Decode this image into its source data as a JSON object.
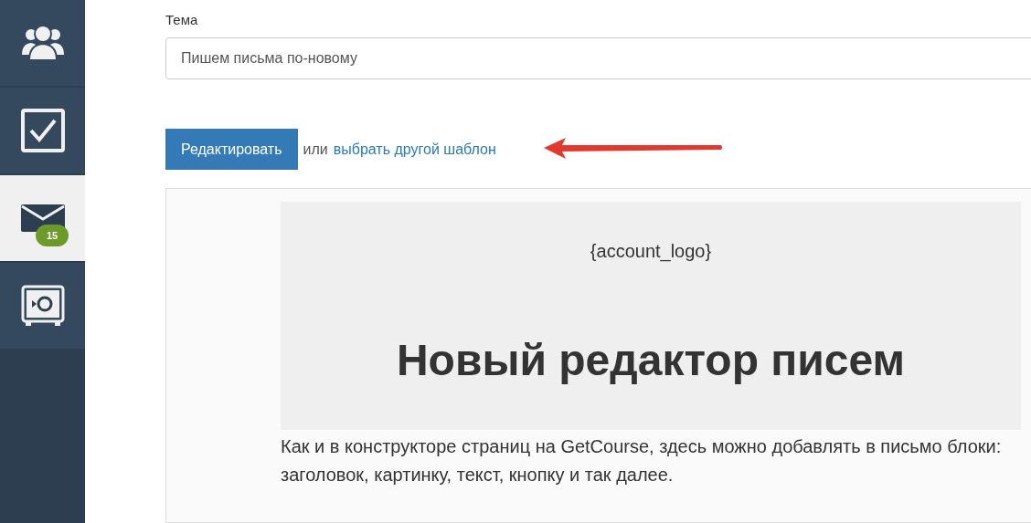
{
  "sidebar": {
    "items": [
      {
        "kind": "users",
        "selected": false
      },
      {
        "kind": "tasks",
        "selected": false
      },
      {
        "kind": "mail",
        "selected": true,
        "badge": "15"
      },
      {
        "kind": "safe",
        "selected": false
      }
    ]
  },
  "subject": {
    "label": "Тема",
    "value": "Пишем письма по-новому"
  },
  "edit_button": "Редактировать",
  "or_text": "или",
  "template_link": "выбрать другой шаблон",
  "preview": {
    "logo": "{account_logo}",
    "heading": "Новый редактор писем",
    "paragraph": "Как и в конструкторе страниц на GetCourse, здесь можно добавлять в письмо блоки: заголовок, картинку, текст, кнопку и так далее."
  }
}
